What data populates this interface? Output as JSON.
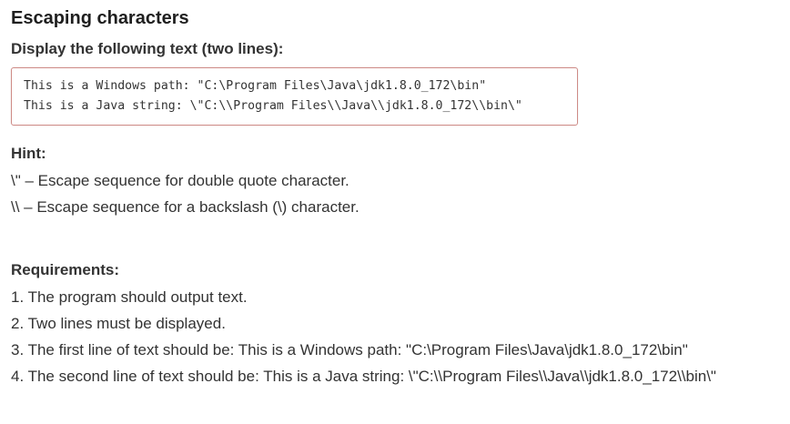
{
  "task": {
    "title": "Escaping characters",
    "subtitle": "Display the following text (two lines):",
    "code_lines": [
      "This is a Windows path: \"C:\\Program Files\\Java\\jdk1.8.0_172\\bin\"",
      "This is a Java string: \\\"C:\\\\Program Files\\\\Java\\\\jdk1.8.0_172\\\\bin\\\""
    ]
  },
  "hint": {
    "heading": "Hint:",
    "lines": [
      "\\\" – Escape sequence for double quote character.",
      "\\\\ – Escape sequence for a backslash (\\) character."
    ]
  },
  "requirements": {
    "heading": "Requirements:",
    "items": [
      "1. The program should output text.",
      "2. Two lines must be displayed.",
      "3. The first line of text should be: This is a Windows path: \"C:\\Program Files\\Java\\jdk1.8.0_172\\bin\"",
      "4. The second line of text should be: This is a Java string: \\\"C:\\\\Program Files\\\\Java\\\\jdk1.8.0_172\\\\bin\\\""
    ]
  },
  "colors": {
    "code_border": "#cf8b86",
    "text": "#333333"
  }
}
